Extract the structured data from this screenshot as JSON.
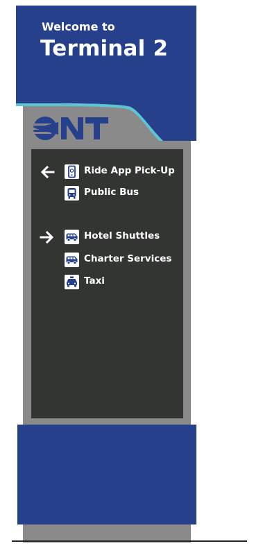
{
  "header": {
    "welcome": "Welcome to",
    "terminal": "Terminal 2"
  },
  "logo": {
    "text": "ONT"
  },
  "directions": [
    {
      "arrow": "left-arrow-icon",
      "icon": "phone-icon",
      "label": "Ride App Pick-Up"
    },
    {
      "arrow": null,
      "icon": "bus-icon",
      "label": "Public Bus"
    },
    {
      "arrow": "right-arrow-icon",
      "icon": "shuttle-icon",
      "label": "Hotel Shuttles"
    },
    {
      "arrow": null,
      "icon": "shuttle-icon",
      "label": "Charter Services"
    },
    {
      "arrow": null,
      "icon": "taxi-icon",
      "label": "Taxi"
    }
  ],
  "colors": {
    "brand_blue": "#27408b",
    "accent_teal": "#5cc4d4",
    "panel_dark": "#333533",
    "pillar_gray": "#8a8a8a"
  }
}
